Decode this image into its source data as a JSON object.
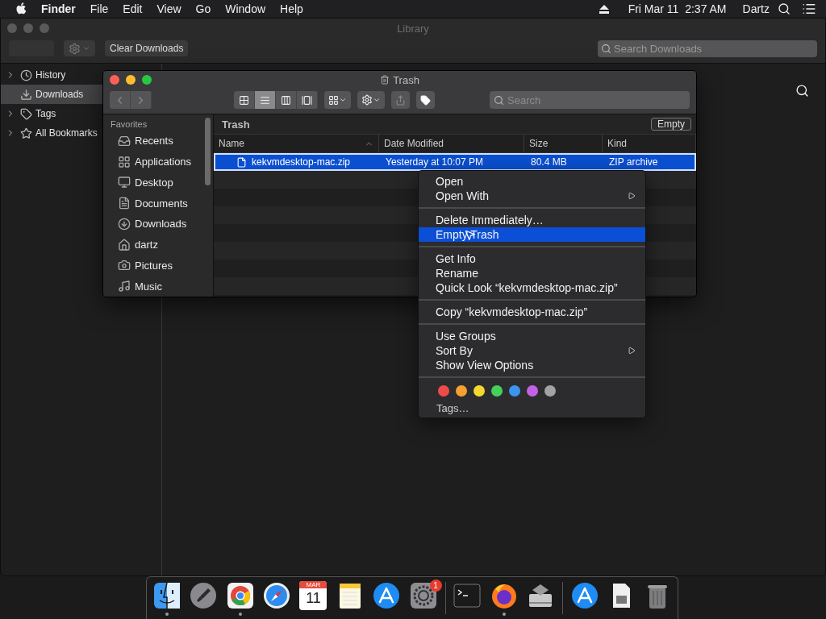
{
  "menubar": {
    "items": [
      {
        "label": "Finder",
        "bold": true
      },
      {
        "label": "File",
        "bold": false
      },
      {
        "label": "Edit",
        "bold": false
      },
      {
        "label": "View",
        "bold": false
      },
      {
        "label": "Go",
        "bold": false
      },
      {
        "label": "Window",
        "bold": false
      },
      {
        "label": "Help",
        "bold": false
      }
    ],
    "clock": "Fri Mar 11  2:37 AM",
    "user": "Dartz"
  },
  "library": {
    "title": "Library",
    "clear_button": "Clear Downloads",
    "search_placeholder": "Search Downloads",
    "sidebar": [
      {
        "label": "History",
        "expandable": true,
        "selected": false
      },
      {
        "label": "Downloads",
        "expandable": false,
        "selected": true
      },
      {
        "label": "Tags",
        "expandable": true,
        "selected": false
      },
      {
        "label": "All Bookmarks",
        "expandable": true,
        "selected": false
      }
    ]
  },
  "finder": {
    "title": "Trash",
    "sidebar_heading": "Favorites",
    "sidebar": [
      {
        "label": "Recents"
      },
      {
        "label": "Applications"
      },
      {
        "label": "Desktop"
      },
      {
        "label": "Documents"
      },
      {
        "label": "Downloads"
      },
      {
        "label": "dartz"
      },
      {
        "label": "Pictures"
      },
      {
        "label": "Music"
      }
    ],
    "path": "Trash",
    "empty_button": "Empty",
    "search_placeholder": "Search",
    "columns": [
      {
        "label": "Name",
        "sorted": true
      },
      {
        "label": "Date Modified",
        "sorted": false
      },
      {
        "label": "Size",
        "sorted": false
      },
      {
        "label": "Kind",
        "sorted": false
      }
    ],
    "rows": [
      {
        "name": "kekvmdesktop-mac.zip",
        "date": "Yesterday at 10:07 PM",
        "size": "80.4 MB",
        "kind": "ZIP archive",
        "selected": true
      }
    ]
  },
  "context_menu": {
    "groups": [
      [
        {
          "label": "Open",
          "submenu": false,
          "selected": false
        },
        {
          "label": "Open With",
          "submenu": true,
          "selected": false
        }
      ],
      [
        {
          "label": "Delete Immediately…",
          "submenu": false,
          "selected": false
        },
        {
          "label": "Empty Trash",
          "submenu": false,
          "selected": true
        }
      ],
      [
        {
          "label": "Get Info",
          "submenu": false,
          "selected": false
        },
        {
          "label": "Rename",
          "submenu": false,
          "selected": false
        },
        {
          "label": "Quick Look “kekvmdesktop-mac.zip”",
          "submenu": false,
          "selected": false
        }
      ],
      [
        {
          "label": "Copy “kekvmdesktop-mac.zip”",
          "submenu": false,
          "selected": false
        }
      ],
      [
        {
          "label": "Use Groups",
          "submenu": false,
          "selected": false
        },
        {
          "label": "Sort By",
          "submenu": true,
          "selected": false
        },
        {
          "label": "Show View Options",
          "submenu": false,
          "selected": false
        }
      ]
    ],
    "tags": [
      {
        "color": "#ee4b4b"
      },
      {
        "color": "#f5a030"
      },
      {
        "color": "#f5d730"
      },
      {
        "color": "#44d05a"
      },
      {
        "color": "#3b95ee"
      },
      {
        "color": "#c462e6"
      },
      {
        "color": "#a3a3a3"
      }
    ],
    "tags_label": "Tags…"
  },
  "dock": [
    {
      "kind": "app",
      "running": true
    },
    {
      "kind": "app",
      "running": false
    },
    {
      "kind": "app",
      "running": true
    },
    {
      "kind": "app",
      "running": false
    },
    {
      "kind": "app",
      "running": false,
      "month": "MAR",
      "day": "11"
    },
    {
      "kind": "app",
      "running": false
    },
    {
      "kind": "app",
      "running": false
    },
    {
      "kind": "app",
      "running": false,
      "badge": "1"
    },
    {
      "kind": "separator"
    },
    {
      "kind": "app",
      "running": false
    },
    {
      "kind": "app",
      "running": true
    },
    {
      "kind": "app",
      "running": false
    },
    {
      "kind": "separator"
    },
    {
      "kind": "app",
      "running": false
    },
    {
      "kind": "app",
      "running": false
    },
    {
      "kind": "app",
      "running": false
    }
  ]
}
